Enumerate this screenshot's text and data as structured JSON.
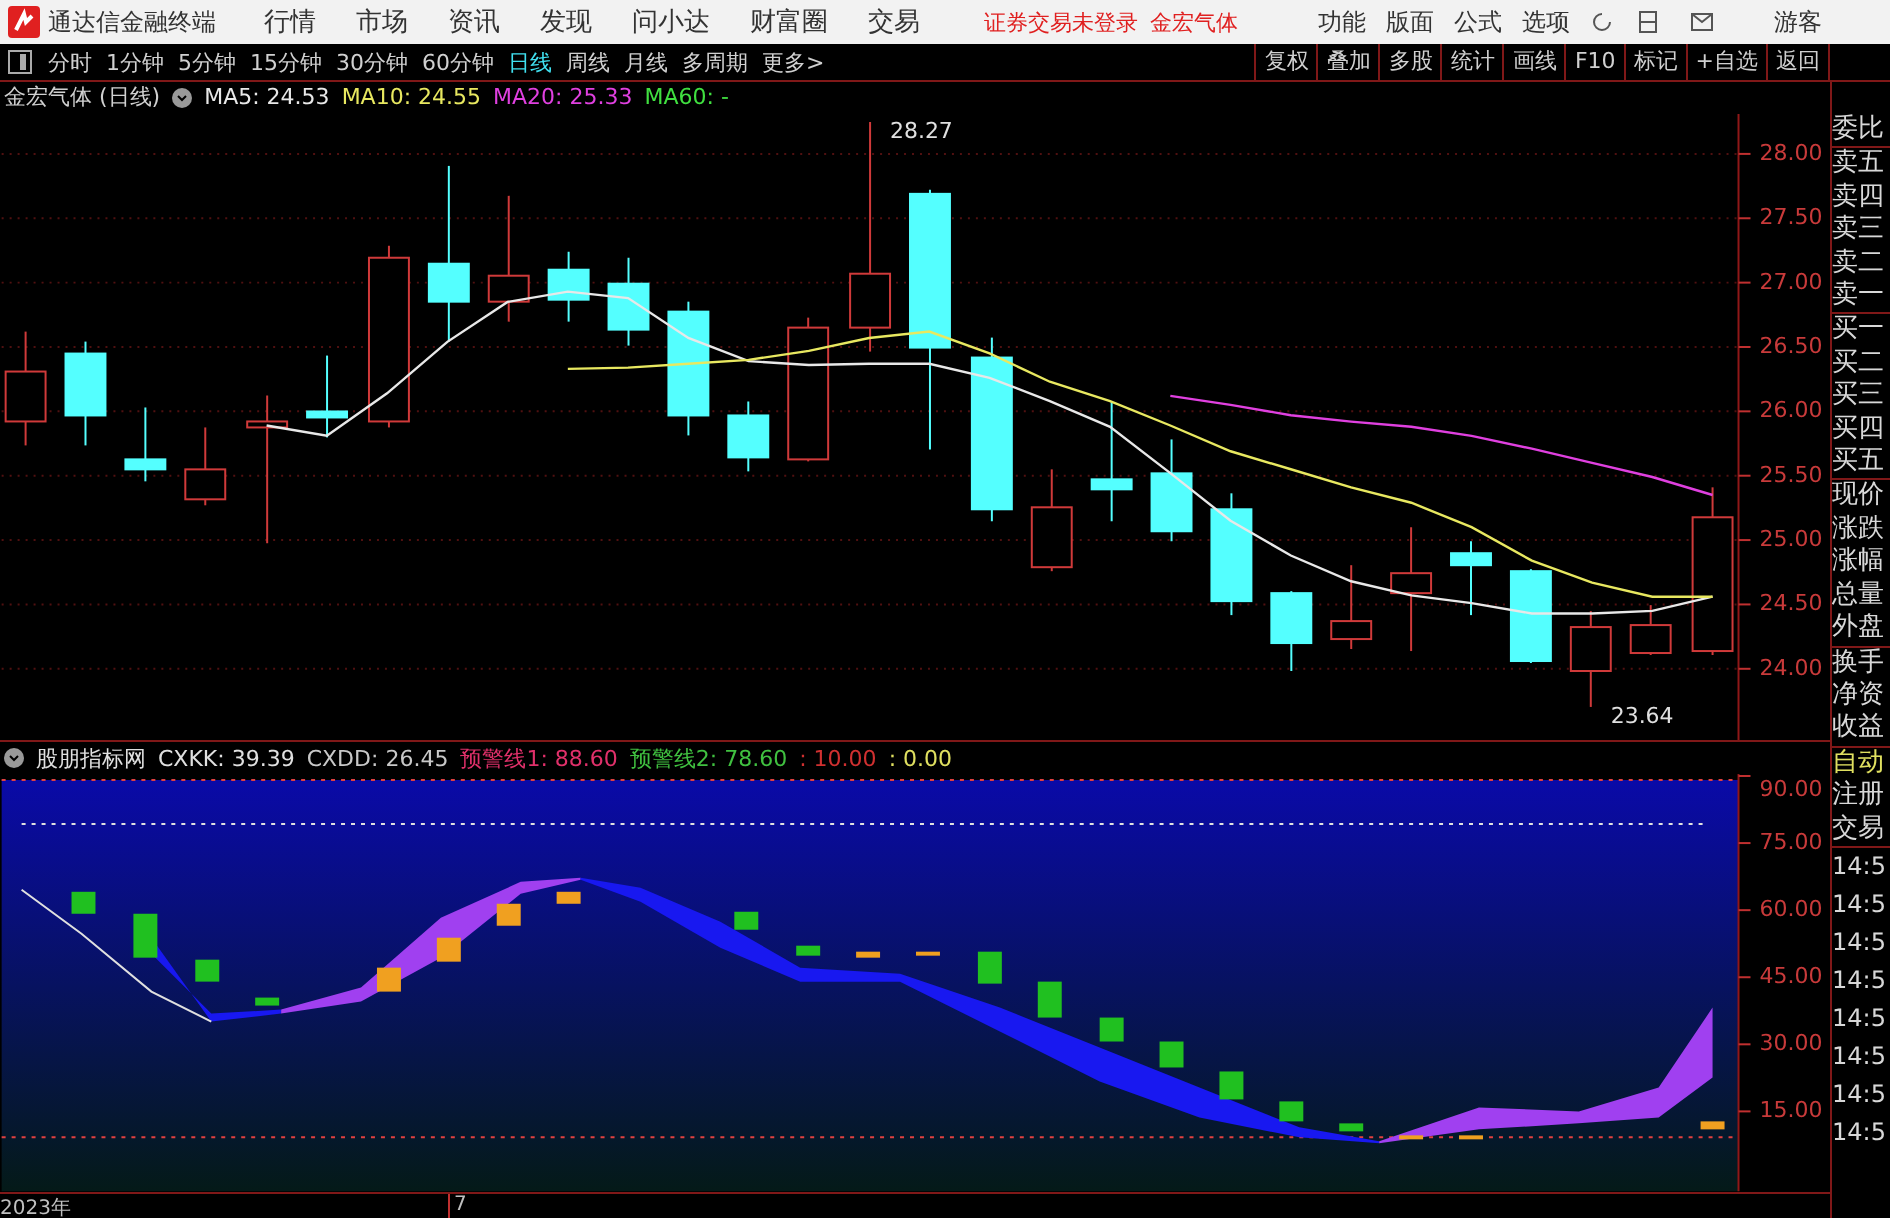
{
  "title_bar": {
    "app_name": "通达信金融终端",
    "menus": [
      "行情",
      "市场",
      "资讯",
      "发现",
      "问小达",
      "财富圈",
      "交易"
    ],
    "notice": "证券交易未登录",
    "stock": "金宏气体",
    "actions": [
      "功能",
      "版面",
      "公式",
      "选项"
    ],
    "user": "游客"
  },
  "toolbar": {
    "periods": [
      {
        "label": "分时",
        "selected": false
      },
      {
        "label": "1分钟",
        "selected": false
      },
      {
        "label": "5分钟",
        "selected": false
      },
      {
        "label": "15分钟",
        "selected": false
      },
      {
        "label": "30分钟",
        "selected": false
      },
      {
        "label": "60分钟",
        "selected": false
      },
      {
        "label": "日线",
        "selected": true
      },
      {
        "label": "周线",
        "selected": false
      },
      {
        "label": "月线",
        "selected": false
      },
      {
        "label": "多周期",
        "selected": false
      },
      {
        "label": "更多>",
        "selected": false
      }
    ],
    "buttons": [
      "复权",
      "叠加",
      "多股",
      "统计",
      "画线",
      "F10",
      "标记",
      "+自选",
      "返回"
    ]
  },
  "price_chart": {
    "title": "金宏气体 (日线)",
    "indicators": [
      {
        "label": "MA5: 24.53",
        "color": "#e8e8e8"
      },
      {
        "label": "MA10: 24.55",
        "color": "#e8e860"
      },
      {
        "label": "MA20: 25.33",
        "color": "#e040e0"
      },
      {
        "label": "MA60: -",
        "color": "#40e040"
      }
    ],
    "high_label": "28.27",
    "low_label": "23.64",
    "chart_data": {
      "type": "line",
      "categories": [
        null,
        null,
        null,
        null,
        null,
        null,
        null,
        null,
        null,
        null,
        null,
        null,
        null,
        null,
        null,
        null,
        null,
        null,
        null,
        null,
        null,
        null,
        null,
        null,
        null,
        null,
        null,
        null,
        null
      ],
      "ylim": [
        23.44,
        28.31
      ],
      "grid": true,
      "yticks": [
        {
          "value": 24,
          "label": "24.00"
        },
        {
          "value": 24.5,
          "label": "24.50"
        },
        {
          "value": 25,
          "label": "25.00"
        },
        {
          "value": 25.5,
          "label": "25.50"
        },
        {
          "value": 26,
          "label": "26.00"
        },
        {
          "value": 26.5,
          "label": "26.50"
        },
        {
          "value": 27,
          "label": "27.00"
        },
        {
          "value": 27.5,
          "label": "27.50"
        },
        {
          "value": 28,
          "label": "28.00"
        }
      ],
      "series": [
        {
          "color": "#e8e8e8",
          "values": [
            null,
            null,
            null,
            null,
            25.89,
            25.81,
            26.14,
            26.54,
            26.85,
            26.93,
            26.88,
            26.57,
            26.39,
            26.36,
            26.37,
            26.37,
            26.26,
            26.08,
            25.88,
            25.52,
            25.15,
            24.88,
            24.68,
            24.57,
            24.51,
            24.43,
            24.43,
            24.45,
            24.56
          ]
        },
        {
          "color": "#e8e860",
          "values": [
            null,
            null,
            null,
            null,
            null,
            null,
            null,
            null,
            null,
            26.33,
            26.34,
            26.37,
            26.4,
            26.47,
            26.57,
            26.62,
            26.45,
            26.23,
            26.08,
            25.89,
            25.69,
            25.55,
            25.41,
            25.29,
            25.1,
            24.84,
            24.67,
            24.56,
            24.56
          ]
        },
        {
          "color": "#e040e0",
          "values": [
            null,
            null,
            null,
            null,
            null,
            null,
            null,
            null,
            null,
            null,
            null,
            null,
            null,
            null,
            null,
            null,
            null,
            null,
            null,
            26.12,
            26.05,
            25.97,
            25.92,
            25.88,
            25.81,
            25.71,
            25.6,
            25.49,
            25.35
          ]
        }
      ]
    }
  },
  "indicator_panel": {
    "items": [
      {
        "label": "股朋指标网",
        "color": "#e0e0e0"
      },
      {
        "label": "CXKK: 39.39",
        "color": "#e0e0e0"
      },
      {
        "label": "CXDD: 26.45",
        "color": "#c8c8c8"
      },
      {
        "label": "预警线1: 88.60",
        "color": "#e0306a"
      },
      {
        "label": "预警线2: 78.60",
        "color": "#40c040"
      },
      {
        "label": ": 10.00",
        "color": "#d03030"
      },
      {
        "label": ": 0.00",
        "color": "#e0e060"
      }
    ],
    "axis_labels": [
      "90.00",
      "75.00",
      "60.00",
      "45.00",
      "30.00",
      "15.00"
    ]
  },
  "x_axis": [
    "2023年",
    "7"
  ],
  "quote_panel": {
    "groups": [
      [
        {
          "label": "委比",
          "highlight": false
        }
      ],
      [
        {
          "label": "卖五",
          "highlight": false
        },
        {
          "label": "卖四",
          "highlight": false
        },
        {
          "label": "卖三",
          "highlight": false
        },
        {
          "label": "卖二",
          "highlight": false
        },
        {
          "label": "卖一",
          "highlight": false
        }
      ],
      [
        {
          "label": "买一",
          "highlight": false
        },
        {
          "label": "买二",
          "highlight": false
        },
        {
          "label": "买三",
          "highlight": false
        },
        {
          "label": "买四",
          "highlight": false
        },
        {
          "label": "买五",
          "highlight": false
        }
      ],
      [
        {
          "label": "现价",
          "highlight": false
        },
        {
          "label": "涨跌",
          "highlight": false
        },
        {
          "label": "涨幅",
          "highlight": false
        },
        {
          "label": "总量",
          "highlight": false
        },
        {
          "label": "外盘",
          "highlight": false
        }
      ],
      [
        {
          "label": "换手",
          "highlight": false
        },
        {
          "label": "净资",
          "highlight": false
        },
        {
          "label": "收益",
          "highlight": false
        }
      ],
      [
        {
          "label": "自动",
          "highlight": true
        },
        {
          "label": "注册",
          "highlight": false
        },
        {
          "label": "交易",
          "highlight": false
        }
      ]
    ],
    "times": [
      "14:5",
      "14:5",
      "14:5",
      "14:5",
      "14:5",
      "14:5",
      "14:5",
      "14:5"
    ]
  }
}
